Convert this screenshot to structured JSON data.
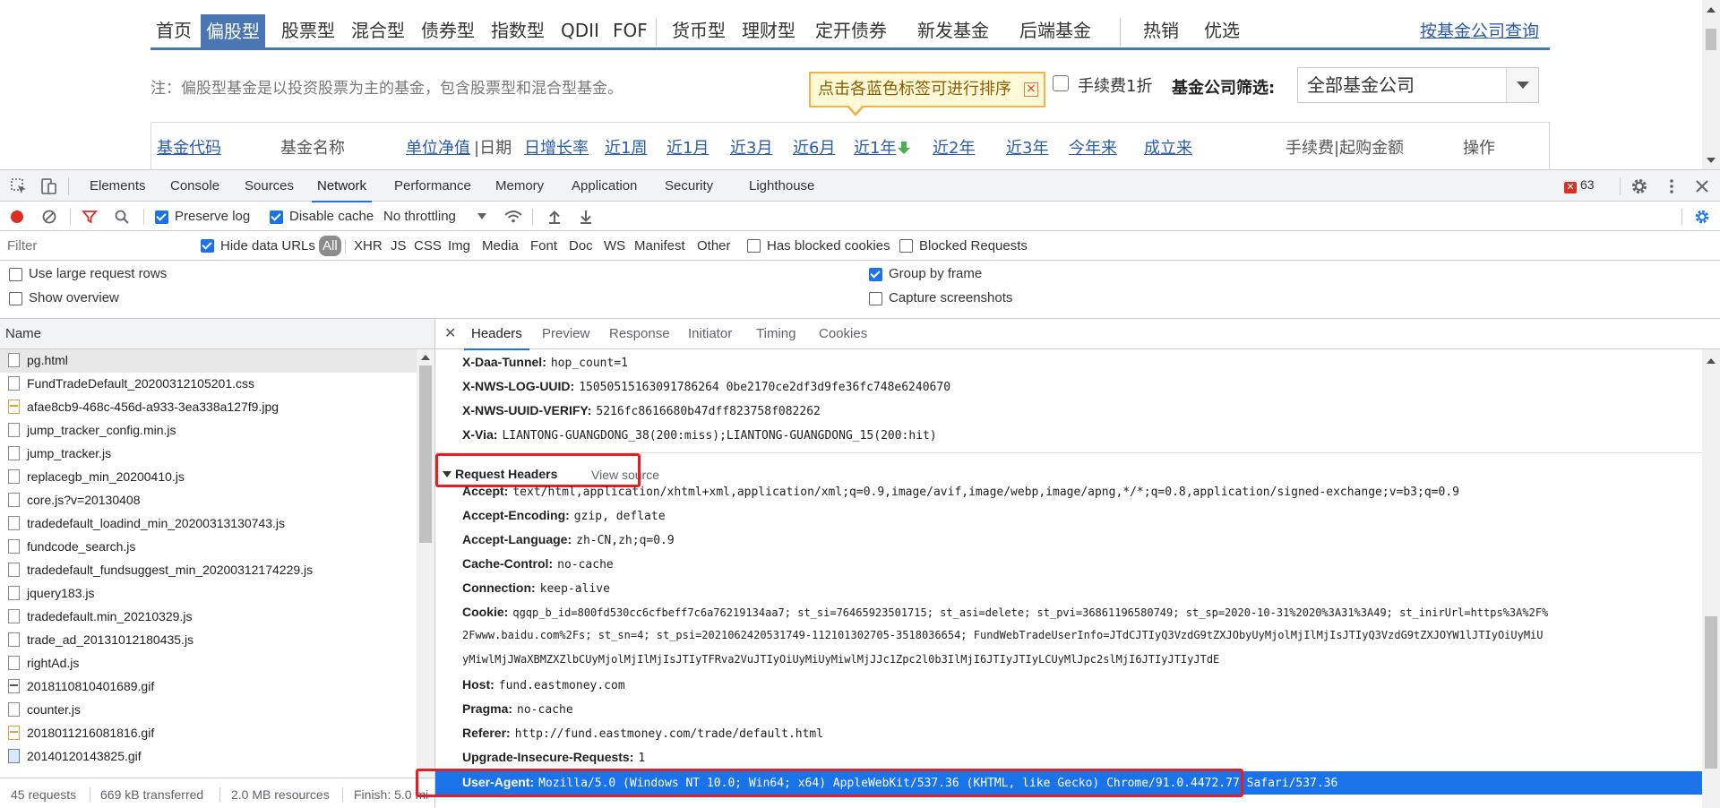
{
  "webpage": {
    "nav": [
      {
        "label": "首页",
        "active": false
      },
      {
        "label": "偏股型",
        "active": true
      },
      {
        "label": "股票型",
        "active": false
      },
      {
        "label": "混合型",
        "active": false
      },
      {
        "label": "债券型",
        "active": false
      },
      {
        "label": "指数型",
        "active": false
      },
      {
        "label": "QDII",
        "active": false
      },
      {
        "label": "FOF",
        "active": false
      },
      {
        "label": "货币型",
        "active": false
      },
      {
        "label": "理财型",
        "active": false
      },
      {
        "label": "定开债券",
        "active": false
      },
      {
        "label": "新发基金",
        "active": false
      },
      {
        "label": "后端基金",
        "active": false
      },
      {
        "label": "热销",
        "active": false
      },
      {
        "label": "优选",
        "active": false
      }
    ],
    "company_query_link": "按基金公司查询",
    "note": "注：偏股型基金是以投资股票为主的基金，包含股票型和混合型基金。",
    "tooltip": "点击各蓝色标签可进行排序",
    "tooltip_close": "×",
    "fee_discount_label": "手续费1折",
    "company_filter_label": "基金公司筛选:",
    "company_filter_value": "全部基金公司",
    "columns": [
      {
        "label": "基金代码",
        "link": true
      },
      {
        "label": "基金名称",
        "link": false
      },
      {
        "label": "单位净值",
        "link": true
      },
      {
        "label": "|日期",
        "link": false
      },
      {
        "label": "日增长率",
        "link": true
      },
      {
        "label": "近1周",
        "link": true
      },
      {
        "label": "近1月",
        "link": true
      },
      {
        "label": "近3月",
        "link": true
      },
      {
        "label": "近6月",
        "link": true
      },
      {
        "label": "近1年",
        "link": true,
        "sort_icon": "sort-down-arrow-icon"
      },
      {
        "label": "近2年",
        "link": true
      },
      {
        "label": "近3年",
        "link": true
      },
      {
        "label": "今年来",
        "link": true
      },
      {
        "label": "成立来",
        "link": true
      },
      {
        "label": "手续费|起购金额",
        "link": false
      },
      {
        "label": "操作",
        "link": false
      }
    ]
  },
  "devtools": {
    "main_tabs": [
      "Elements",
      "Console",
      "Sources",
      "Network",
      "Performance",
      "Memory",
      "Application",
      "Security",
      "Lighthouse"
    ],
    "active_main_tab": "Network",
    "error_count": "63",
    "toolbar": {
      "preserve_log": "Preserve log",
      "disable_cache": "Disable cache",
      "throttling": "No throttling"
    },
    "filter": {
      "placeholder": "Filter",
      "hide_data_urls": "Hide data URLs",
      "types": [
        "All",
        "XHR",
        "JS",
        "CSS",
        "Img",
        "Media",
        "Font",
        "Doc",
        "WS",
        "Manifest",
        "Other"
      ],
      "has_blocked_cookies": "Has blocked cookies",
      "blocked_requests": "Blocked Requests"
    },
    "options": {
      "large_rows": "Use large request rows",
      "show_overview": "Show overview",
      "group_by_frame": "Group by frame",
      "capture_screenshots": "Capture screenshots"
    },
    "name_header": "Name",
    "requests": [
      {
        "name": "pg.html",
        "kind": "doc",
        "selected": true
      },
      {
        "name": "FundTradeDefault_20200312105201.css",
        "kind": "doc"
      },
      {
        "name": "afae8cb9-468c-456d-a933-3ea338a127f9.jpg",
        "kind": "img"
      },
      {
        "name": "jump_tracker_config.min.js",
        "kind": "doc"
      },
      {
        "name": "jump_tracker.js",
        "kind": "doc"
      },
      {
        "name": "replacegb_min_20200410.js",
        "kind": "doc"
      },
      {
        "name": "core.js?v=20130408",
        "kind": "doc"
      },
      {
        "name": "tradedefault_loadind_min_20200313130743.js",
        "kind": "doc"
      },
      {
        "name": "fundcode_search.js",
        "kind": "doc"
      },
      {
        "name": "tradedefault_fundsuggest_min_20200312174229.js",
        "kind": "doc"
      },
      {
        "name": "jquery183.js",
        "kind": "doc"
      },
      {
        "name": "tradedefault.min_20210329.js",
        "kind": "doc"
      },
      {
        "name": "trade_ad_20131012180435.js",
        "kind": "doc"
      },
      {
        "name": "rightAd.js",
        "kind": "doc"
      },
      {
        "name": "2018110810401689.gif",
        "kind": "gif"
      },
      {
        "name": "counter.js",
        "kind": "doc"
      },
      {
        "name": "2018011216081816.gif",
        "kind": "img"
      },
      {
        "name": "20140120143825.gif",
        "kind": "png"
      }
    ],
    "status": {
      "requests": "45 requests",
      "transferred": "669 kB transferred",
      "resources": "2.0 MB resources",
      "finish": "Finish: 5.0 mi"
    },
    "detail_tabs": [
      "Headers",
      "Preview",
      "Response",
      "Initiator",
      "Timing",
      "Cookies"
    ],
    "active_detail_tab": "Headers",
    "response_headers": [
      {
        "key": "X-Daa-Tunnel:",
        "value": "hop_count=1"
      },
      {
        "key": "X-NWS-LOG-UUID:",
        "value": "15050515163091786264 0be2170ce2df3d9fe36fc748e6240670"
      },
      {
        "key": "X-NWS-UUID-VERIFY:",
        "value": "5216fc8616680b47dff823758f082262"
      },
      {
        "key": "X-Via:",
        "value": "LIANTONG-GUANGDONG_38(200:miss);LIANTONG-GUANGDONG_15(200:hit)"
      }
    ],
    "request_headers_title": "Request Headers",
    "view_source": "View source",
    "request_headers": {
      "accept": {
        "key": "Accept:",
        "value": "text/html,application/xhtml+xml,application/xml;q=0.9,image/avif,image/webp,image/apng,*/*;q=0.8,application/signed-exchange;v=b3;q=0.9"
      },
      "accept_encoding": {
        "key": "Accept-Encoding:",
        "value": "gzip, deflate"
      },
      "accept_language": {
        "key": "Accept-Language:",
        "value": "zh-CN,zh;q=0.9"
      },
      "cache_control": {
        "key": "Cache-Control:",
        "value": "no-cache"
      },
      "connection": {
        "key": "Connection:",
        "value": "keep-alive"
      },
      "cookie": {
        "key": "Cookie:",
        "value_line1": "qgqp_b_id=800fd530cc6cfbeff7c6a76219134aa7; st_si=76465923501715; st_asi=delete; st_pvi=36861196580749; st_sp=2020-10-31%2020%3A31%3A49; st_inirUrl=https%3A%2F%",
        "value_line2": "2Fwww.baidu.com%2Fs; st_sn=4; st_psi=2021062420531749-112101302705-3518036654; FundWebTradeUserInfo=JTdCJTIyQ3VzdG9tZXJObyUyMjolMjIlMjIsJTIyQ3VzdG9tZXJOYW1lJTIyOiUyMiU",
        "value_line3": "yMiwlMjJWaXBMZXZlbCUyMjolMjIlMjIsJTIyTFRva2VuJTIyOiUyMiUyMiwlMjJJc1Zpc2l0b3IlMjI6JTIyJTIyLCUyMlJpc2slMjI6JTIyJTIyJTdE"
      },
      "host": {
        "key": "Host:",
        "value": "fund.eastmoney.com"
      },
      "pragma": {
        "key": "Pragma:",
        "value": "no-cache"
      },
      "referer": {
        "key": "Referer:",
        "value": "http://fund.eastmoney.com/trade/default.html"
      },
      "upgrade": {
        "key": "Upgrade-Insecure-Requests:",
        "value": "1"
      },
      "user_agent": {
        "key": "User-Agent:",
        "value": "Mozilla/5.0 (Windows NT 10.0; Win64; x64) AppleWebKit/537.36 (KHTML, like Gecko) Chrome/91.0.4472.77 Safari/537.36"
      }
    }
  }
}
